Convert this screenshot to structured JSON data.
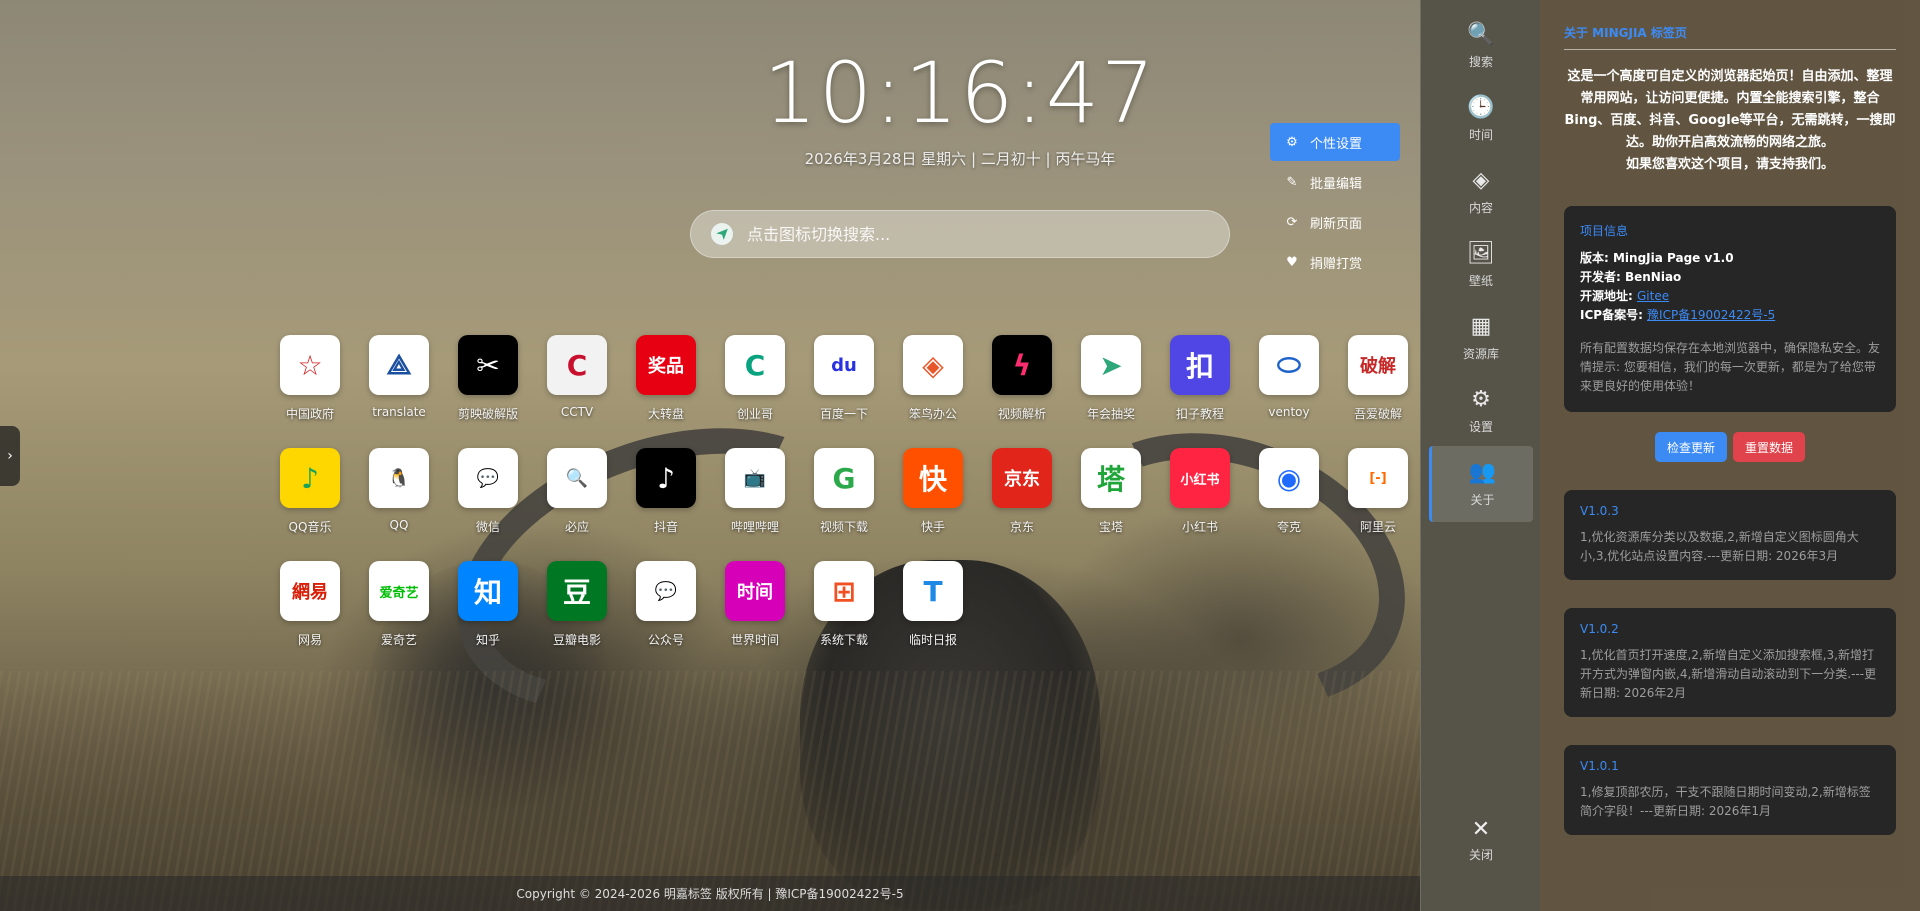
{
  "clock": {
    "time": "10:16:47",
    "date": "2026年3月28日 星期六 | 二月初十 | 丙午马年"
  },
  "search": {
    "placeholder": "点击图标切换搜索..."
  },
  "actions": [
    {
      "label": "个性设置",
      "icon": "gear-icon"
    },
    {
      "label": "批量编辑",
      "icon": "edit-icon"
    },
    {
      "label": "刷新页面",
      "icon": "refresh-icon"
    },
    {
      "label": "捐赠打赏",
      "icon": "heart-icon"
    }
  ],
  "sites": [
    {
      "label": "中国政府",
      "bg": "#ffffff",
      "fg": "#d21e1e",
      "glyph": "☆"
    },
    {
      "label": "translate",
      "bg": "#ffffff",
      "fg": "#1b4fa0",
      "glyph": "⟁"
    },
    {
      "label": "剪映破解版",
      "bg": "#000000",
      "fg": "#ffffff",
      "glyph": "✂"
    },
    {
      "label": "CCTV",
      "bg": "#f2f2f2",
      "fg": "#c8102e",
      "glyph": "C"
    },
    {
      "label": "大转盘",
      "bg": "#e60012",
      "fg": "#ffffff",
      "glyph": "奖品"
    },
    {
      "label": "创业哥",
      "bg": "#ffffff",
      "fg": "#0aa37f",
      "glyph": "C"
    },
    {
      "label": "百度一下",
      "bg": "#ffffff",
      "fg": "#2932e1",
      "glyph": "du"
    },
    {
      "label": "笨鸟办公",
      "bg": "#ffffff",
      "fg": "#e8572a",
      "glyph": "◈"
    },
    {
      "label": "视频解析",
      "bg": "#000000",
      "fg": "#ff2d6f",
      "glyph": "ϟ"
    },
    {
      "label": "年会抽奖",
      "bg": "#ffffff",
      "fg": "#2ea77a",
      "glyph": "➤"
    },
    {
      "label": "扣子教程",
      "bg": "#4f46e5",
      "fg": "#ffffff",
      "glyph": "扣"
    },
    {
      "label": "ventoy",
      "bg": "#ffffff",
      "fg": "#1e63c9",
      "glyph": "⬭"
    },
    {
      "label": "吾爱破解",
      "bg": "#ffffff",
      "fg": "#c62828",
      "glyph": "破解"
    },
    {
      "label": "QQ音乐",
      "bg": "#ffd700",
      "fg": "#18a35a",
      "glyph": "♪"
    },
    {
      "label": "QQ",
      "bg": "#ffffff",
      "fg": "#111111",
      "glyph": "🐧"
    },
    {
      "label": "微信",
      "bg": "#ffffff",
      "fg": "#2dc100",
      "glyph": "💬"
    },
    {
      "label": "必应",
      "bg": "#ffffff",
      "fg": "#2b7de9",
      "glyph": "🔍"
    },
    {
      "label": "抖音",
      "bg": "#000000",
      "fg": "#ffffff",
      "glyph": "♪"
    },
    {
      "label": "哔哩哔哩",
      "bg": "#ffffff",
      "fg": "#00a1d6",
      "glyph": "📺"
    },
    {
      "label": "视频下载",
      "bg": "#ffffff",
      "fg": "#2aa84a",
      "glyph": "G"
    },
    {
      "label": "快手",
      "bg": "#ff5000",
      "fg": "#ffffff",
      "glyph": "快"
    },
    {
      "label": "京东",
      "bg": "#e1251b",
      "fg": "#ffffff",
      "glyph": "京东"
    },
    {
      "label": "宝塔",
      "bg": "#ffffff",
      "fg": "#20a53a",
      "glyph": "塔"
    },
    {
      "label": "小红书",
      "bg": "#ff2442",
      "fg": "#ffffff",
      "glyph": "小红书"
    },
    {
      "label": "夸克",
      "bg": "#ffffff",
      "fg": "#1f6bff",
      "glyph": "◉"
    },
    {
      "label": "阿里云",
      "bg": "#ffffff",
      "fg": "#ff6a00",
      "glyph": "[-]"
    },
    {
      "label": "网易",
      "bg": "#ffffff",
      "fg": "#d81e06",
      "glyph": "網易"
    },
    {
      "label": "爱奇艺",
      "bg": "#ffffff",
      "fg": "#00be06",
      "glyph": "爱奇艺"
    },
    {
      "label": "知乎",
      "bg": "#0084ff",
      "fg": "#ffffff",
      "glyph": "知"
    },
    {
      "label": "豆瓣电影",
      "bg": "#007722",
      "fg": "#ffffff",
      "glyph": "豆"
    },
    {
      "label": "公众号",
      "bg": "#ffffff",
      "fg": "#2dc100",
      "glyph": "💬"
    },
    {
      "label": "世界时间",
      "bg": "#d600b9",
      "fg": "#ffffff",
      "glyph": "时间"
    },
    {
      "label": "系统下载",
      "bg": "#ffffff",
      "fg": "#f25022",
      "glyph": "⊞"
    },
    {
      "label": "临时日报",
      "bg": "#ffffff",
      "fg": "#1e88e5",
      "glyph": "T"
    }
  ],
  "footer": {
    "text": "Copyright © 2024-2026 明嘉标签 版权所有 | 豫ICP备19002422号-5"
  },
  "sidenav": [
    {
      "label": "搜索",
      "icon": "search-icon",
      "glyph": "🔍"
    },
    {
      "label": "时间",
      "icon": "clock-icon",
      "glyph": "🕒"
    },
    {
      "label": "内容",
      "icon": "layers-icon",
      "glyph": "◈"
    },
    {
      "label": "壁纸",
      "icon": "image-icon",
      "glyph": "🖼"
    },
    {
      "label": "资源库",
      "icon": "boxes-icon",
      "glyph": "▦"
    },
    {
      "label": "设置",
      "icon": "gear-icon",
      "glyph": "⚙"
    },
    {
      "label": "关于",
      "icon": "users-icon",
      "glyph": "👥"
    }
  ],
  "close": {
    "label": "关闭"
  },
  "about": {
    "title": "关于 MINGJIA 标签页",
    "desc1": "这是一个高度可自定义的浏览器起始页！自由添加、整理常用网站，让访问更便捷。内置全能搜索引擎，整合Bing、百度、抖音、Google等平台，无需跳转，一搜即达。助你开启高效流畅的网络之旅。",
    "desc2": "如果您喜欢这个项目，请支持我们。",
    "info": {
      "title": "项目信息",
      "version": "版本: MingJia Page v1.0",
      "developer": "开发者: BenNiao",
      "source_label": "开源地址: ",
      "source_link": "Gitee",
      "icp_label": "ICP备案号: ",
      "icp_link": "豫ICP备19002422号-5",
      "note": "所有配置数据均保存在本地浏览器中，确保隐私安全。友情提示: 您要相信，我们的每一次更新，都是为了给您带来更良好的使用体验！"
    },
    "check_update": "检查更新",
    "reset_data": "重置数据",
    "versions": [
      {
        "title": "V1.0.3",
        "text": "1,优化资源库分类以及数据,2,新增自定义图标圆角大小,3,优化站点设置内容.---更新日期: 2026年3月"
      },
      {
        "title": "V1.0.2",
        "text": "1,优化首页打开速度,2,新增自定义添加搜索框,3,新增打开方式为弹窗内嵌,4,新增滑动自动滚动到下一分类.---更新日期: 2026年2月"
      },
      {
        "title": "V1.0.1",
        "text": "1,修复顶部农历，干支不跟随日期时间变动,2,新增标签简介字段！---更新日期: 2026年1月"
      }
    ]
  }
}
